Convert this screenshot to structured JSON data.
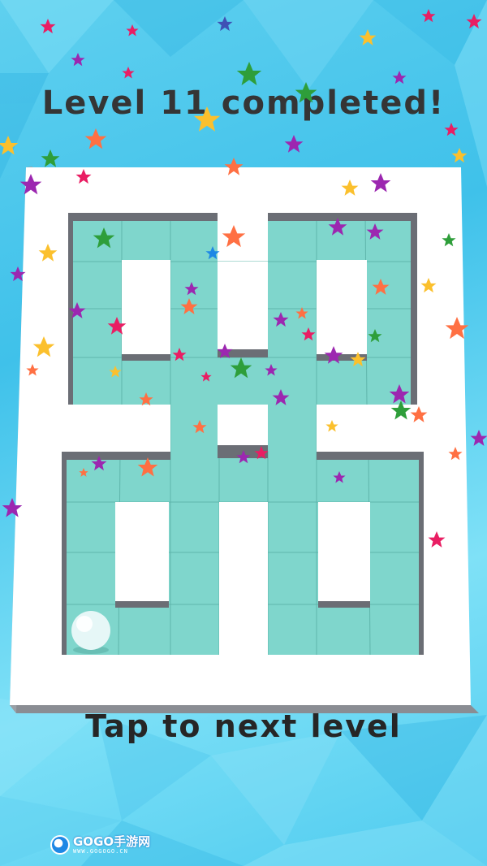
{
  "game": {
    "title": "Level 11 completed!",
    "cta": "Tap to next level"
  },
  "watermark": {
    "brand": "GOGO手游网",
    "url": "WWW.GOGOGO.CN"
  },
  "colors": {
    "floor": "#7fd6cc",
    "grid_line": "#5fb5ab",
    "wall_top": "#ffffff",
    "wall_side": "#6b6e75",
    "background": "#45c6ec",
    "text": "#333333",
    "ball": "#e6f7f7"
  },
  "icons": {
    "ball": "ball-icon",
    "stars": "star-icon",
    "logo": "gogo-logo-icon"
  }
}
